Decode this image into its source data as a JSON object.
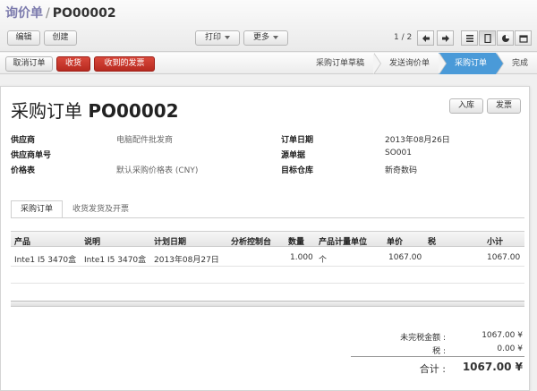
{
  "breadcrumb": {
    "parent": "询价单",
    "separator": "/",
    "current": "PO00002"
  },
  "toolbar": {
    "edit": "编辑",
    "create": "创建",
    "print": "打印",
    "more": "更多",
    "pager": "1 / 2"
  },
  "status_actions": {
    "cancel": "取消订单",
    "receive": "收货",
    "invoices": "收到的发票"
  },
  "stages": [
    {
      "label": "采购订单草稿"
    },
    {
      "label": "发送询价单"
    },
    {
      "label": "采购订单"
    },
    {
      "label": "完成"
    }
  ],
  "header_buttons": {
    "stock_in": "入库",
    "invoice": "发票"
  },
  "record": {
    "title_prefix": "采购订单",
    "title_number": "PO00002"
  },
  "fields_left": [
    {
      "label": "供应商",
      "value": "电脑配件批发商"
    },
    {
      "label": "供应商单号",
      "value": ""
    },
    {
      "label": "价格表",
      "value": "默认采购价格表 (CNY)"
    }
  ],
  "fields_right": [
    {
      "label": "订单日期",
      "value": "2013年08月26日"
    },
    {
      "label": "源单据",
      "value": "SO001"
    },
    {
      "label": "目标仓库",
      "value": "新奇数码"
    }
  ],
  "tabs": [
    {
      "label": "采购订单"
    },
    {
      "label": "收货发货及开票"
    }
  ],
  "table": {
    "headers": [
      "产品",
      "说明",
      "计划日期",
      "分析控制台",
      "数量",
      "产品计量单位",
      "单价",
      "税",
      "小计"
    ],
    "rows": [
      [
        "Inte1 I5 3470盒",
        "Inte1 I5 3470盒",
        "2013年08月27日",
        "",
        "1.000",
        "个",
        "1067.00",
        "",
        "1067.00"
      ]
    ]
  },
  "totals": {
    "untaxed_label": "未完税金额 :",
    "untaxed_value": "1067.00 ¥",
    "tax_label": "税 :",
    "tax_value": "0.00 ¥",
    "total_label": "合计 :",
    "total_value": "1067.00 ¥"
  },
  "colors": {
    "stage_current": "#4a9ad8",
    "danger_button": "#c0392b",
    "breadcrumb_link": "#7c7bad"
  }
}
